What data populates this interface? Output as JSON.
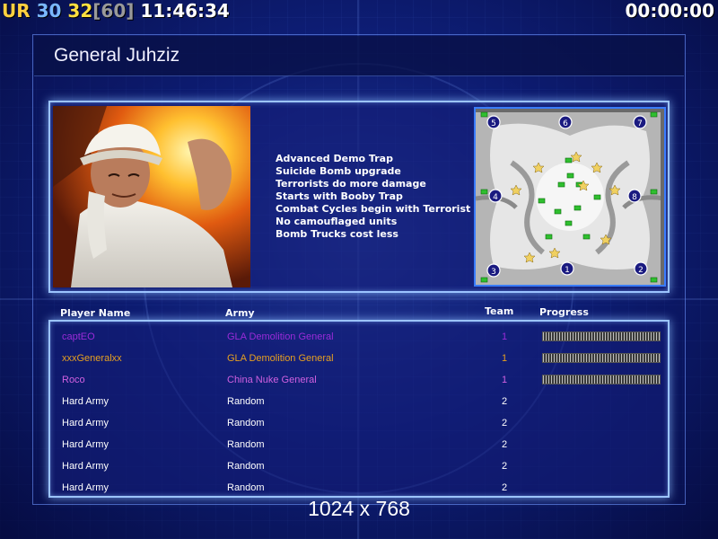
{
  "hud": {
    "ur": "UR",
    "fps": "30",
    "frames": "32",
    "limit": "[60]",
    "clock": "11:46:34",
    "timer": "00:00:00"
  },
  "general": {
    "title": "General Juhziz",
    "traits": [
      "Advanced Demo Trap",
      "Suicide Bomb upgrade",
      "Terrorists do more damage",
      "Starts with Booby Trap",
      "Combat Cycles begin with Terrorist",
      "No camouflaged units",
      "Bomb Trucks cost less"
    ]
  },
  "minimap": {
    "start_positions": [
      "5",
      "6",
      "7",
      "4",
      "8",
      "3",
      "1",
      "2"
    ]
  },
  "table": {
    "headers": {
      "player": "Player Name",
      "army": "Army",
      "team": "Team",
      "progress": "Progress"
    },
    "rows": [
      {
        "name": "captEO",
        "army": "GLA Demolition General",
        "team": "1",
        "color": "#9a2bd8",
        "progress": 1
      },
      {
        "name": "xxxGeneralxx",
        "army": "GLA Demolition General",
        "team": "1",
        "color": "#e6a020",
        "progress": 1
      },
      {
        "name": "Roco",
        "army": "China Nuke General",
        "team": "1",
        "color": "#d060e0",
        "progress": 1
      },
      {
        "name": "Hard Army",
        "army": "Random",
        "team": "2",
        "color": "#ffffff",
        "progress": null
      },
      {
        "name": "Hard Army",
        "army": "Random",
        "team": "2",
        "color": "#ffffff",
        "progress": null
      },
      {
        "name": "Hard Army",
        "army": "Random",
        "team": "2",
        "color": "#ffffff",
        "progress": null
      },
      {
        "name": "Hard Army",
        "army": "Random",
        "team": "2",
        "color": "#ffffff",
        "progress": null
      },
      {
        "name": "Hard Army",
        "army": "Random",
        "team": "2",
        "color": "#ffffff",
        "progress": null
      }
    ]
  },
  "resolution": "1024 x 768",
  "colors": {
    "background": "#0b1a70",
    "panel_border": "#9cc4ff",
    "minimap_border": "#3a7cff"
  }
}
